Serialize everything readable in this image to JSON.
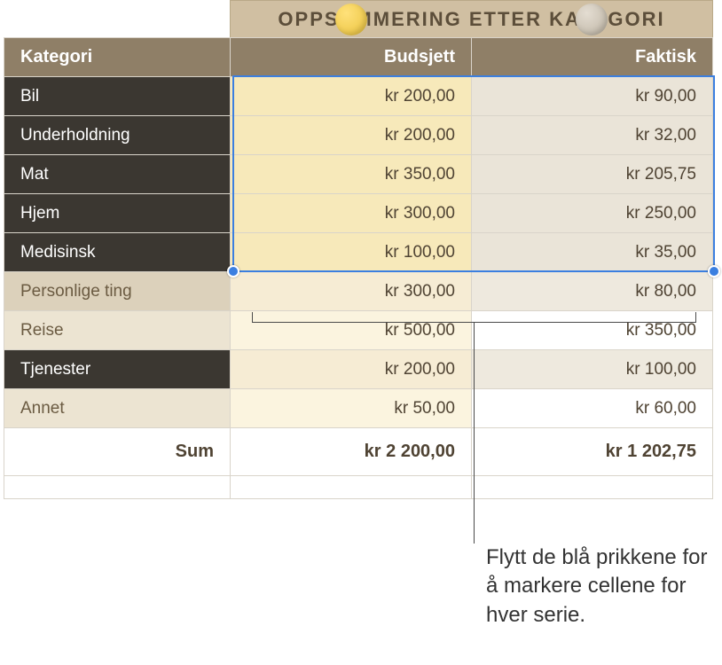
{
  "title": "OPPSUMMERING ETTER KATEGORI",
  "headers": {
    "category": "Kategori",
    "budget": "Budsjett",
    "actual": "Faktisk"
  },
  "rows": [
    {
      "category": "Bil",
      "budget": "kr 200,00",
      "actual": "kr 90,00"
    },
    {
      "category": "Underholdning",
      "budget": "kr 200,00",
      "actual": "kr 32,00"
    },
    {
      "category": "Mat",
      "budget": "kr 350,00",
      "actual": "kr 205,75"
    },
    {
      "category": "Hjem",
      "budget": "kr 300,00",
      "actual": "kr 250,00"
    },
    {
      "category": "Medisinsk",
      "budget": "kr 100,00",
      "actual": "kr 35,00"
    },
    {
      "category": "Personlige ting",
      "budget": "kr 300,00",
      "actual": "kr 80,00"
    },
    {
      "category": "Reise",
      "budget": "kr 500,00",
      "actual": "kr 350,00"
    },
    {
      "category": "Tjenester",
      "budget": "kr 200,00",
      "actual": "kr 100,00"
    },
    {
      "category": "Annet",
      "budget": "kr 50,00",
      "actual": "kr 60,00"
    }
  ],
  "sum": {
    "label": "Sum",
    "budget": "kr 2 200,00",
    "actual": "kr 1 202,75"
  },
  "callout": "Flytt de blå prikkene for å markere cellene for hver serie."
}
